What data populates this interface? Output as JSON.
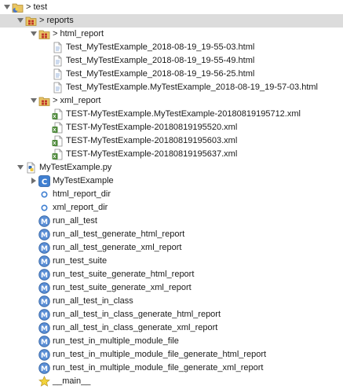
{
  "tree": {
    "rows": [
      {
        "name": "project-test-row",
        "icon": "project-folder-icon",
        "label": "> test",
        "toggle": "expanded",
        "depth": 0,
        "selected": false
      },
      {
        "name": "folder-reports-row",
        "icon": "package-folder-icon",
        "label": "> reports",
        "toggle": "expanded",
        "depth": 1,
        "selected": true
      },
      {
        "name": "folder-html-report-row",
        "icon": "package-folder-icon",
        "label": "> html_report",
        "toggle": "expanded",
        "depth": 2,
        "selected": false
      },
      {
        "name": "file-html-row",
        "icon": "html-file-icon",
        "label": "Test_MyTestExample_2018-08-19_19-55-03.html",
        "toggle": "none",
        "depth": 3,
        "selected": false
      },
      {
        "name": "file-html-row",
        "icon": "html-file-icon",
        "label": "Test_MyTestExample_2018-08-19_19-55-49.html",
        "toggle": "none",
        "depth": 3,
        "selected": false
      },
      {
        "name": "file-html-row",
        "icon": "html-file-icon",
        "label": "Test_MyTestExample_2018-08-19_19-56-25.html",
        "toggle": "none",
        "depth": 3,
        "selected": false
      },
      {
        "name": "file-html-row",
        "icon": "html-file-icon",
        "label": "Test_MyTestExample.MyTestExample_2018-08-19_19-57-03.html",
        "toggle": "none",
        "depth": 3,
        "selected": false
      },
      {
        "name": "folder-xml-report-row",
        "icon": "package-folder-icon",
        "label": "> xml_report",
        "toggle": "expanded",
        "depth": 2,
        "selected": false
      },
      {
        "name": "file-xml-row",
        "icon": "xml-file-icon",
        "label": "TEST-MyTestExample.MyTestExample-20180819195712.xml",
        "toggle": "none",
        "depth": 3,
        "selected": false
      },
      {
        "name": "file-xml-row",
        "icon": "xml-file-icon",
        "label": "TEST-MyTestExample-20180819195520.xml",
        "toggle": "none",
        "depth": 3,
        "selected": false
      },
      {
        "name": "file-xml-row",
        "icon": "xml-file-icon",
        "label": "TEST-MyTestExample-20180819195603.xml",
        "toggle": "none",
        "depth": 3,
        "selected": false
      },
      {
        "name": "file-xml-row",
        "icon": "xml-file-icon",
        "label": "TEST-MyTestExample-20180819195637.xml",
        "toggle": "none",
        "depth": 3,
        "selected": false
      },
      {
        "name": "python-module-row",
        "icon": "python-module-icon",
        "label": "MyTestExample.py",
        "toggle": "expanded",
        "depth": 1,
        "selected": false
      },
      {
        "name": "class-row",
        "icon": "class-icon",
        "label": "MyTestExample",
        "toggle": "collapsed",
        "depth": 2,
        "selected": false
      },
      {
        "name": "variable-row",
        "icon": "variable-icon",
        "label": "html_report_dir",
        "toggle": "none",
        "depth": 2,
        "selected": false
      },
      {
        "name": "variable-row",
        "icon": "variable-icon",
        "label": "xml_report_dir",
        "toggle": "none",
        "depth": 2,
        "selected": false
      },
      {
        "name": "method-row",
        "icon": "method-icon",
        "label": "run_all_test",
        "toggle": "none",
        "depth": 2,
        "selected": false
      },
      {
        "name": "method-row",
        "icon": "method-icon",
        "label": "run_all_test_generate_html_report",
        "toggle": "none",
        "depth": 2,
        "selected": false
      },
      {
        "name": "method-row",
        "icon": "method-icon",
        "label": "run_all_test_generate_xml_report",
        "toggle": "none",
        "depth": 2,
        "selected": false
      },
      {
        "name": "method-row",
        "icon": "method-icon",
        "label": "run_test_suite",
        "toggle": "none",
        "depth": 2,
        "selected": false
      },
      {
        "name": "method-row",
        "icon": "method-icon",
        "label": "run_test_suite_generate_html_report",
        "toggle": "none",
        "depth": 2,
        "selected": false
      },
      {
        "name": "method-row",
        "icon": "method-icon",
        "label": "run_test_suite_generate_xml_report",
        "toggle": "none",
        "depth": 2,
        "selected": false
      },
      {
        "name": "method-row",
        "icon": "method-icon",
        "label": "run_all_test_in_class",
        "toggle": "none",
        "depth": 2,
        "selected": false
      },
      {
        "name": "method-row",
        "icon": "method-icon",
        "label": "run_all_test_in_class_generate_html_report",
        "toggle": "none",
        "depth": 2,
        "selected": false
      },
      {
        "name": "method-row",
        "icon": "method-icon",
        "label": "run_all_test_in_class_generate_xml_report",
        "toggle": "none",
        "depth": 2,
        "selected": false
      },
      {
        "name": "method-row",
        "icon": "method-icon",
        "label": "run_test_in_multiple_module_file",
        "toggle": "none",
        "depth": 2,
        "selected": false
      },
      {
        "name": "method-row",
        "icon": "method-icon",
        "label": "run_test_in_multiple_module_file_generate_html_report",
        "toggle": "none",
        "depth": 2,
        "selected": false
      },
      {
        "name": "method-row",
        "icon": "method-icon",
        "label": "run_test_in_multiple_module_file_generate_xml_report",
        "toggle": "none",
        "depth": 2,
        "selected": false
      },
      {
        "name": "main-block-row",
        "icon": "main-star-icon",
        "label": "__main__",
        "toggle": "none",
        "depth": 2,
        "selected": false
      }
    ]
  }
}
